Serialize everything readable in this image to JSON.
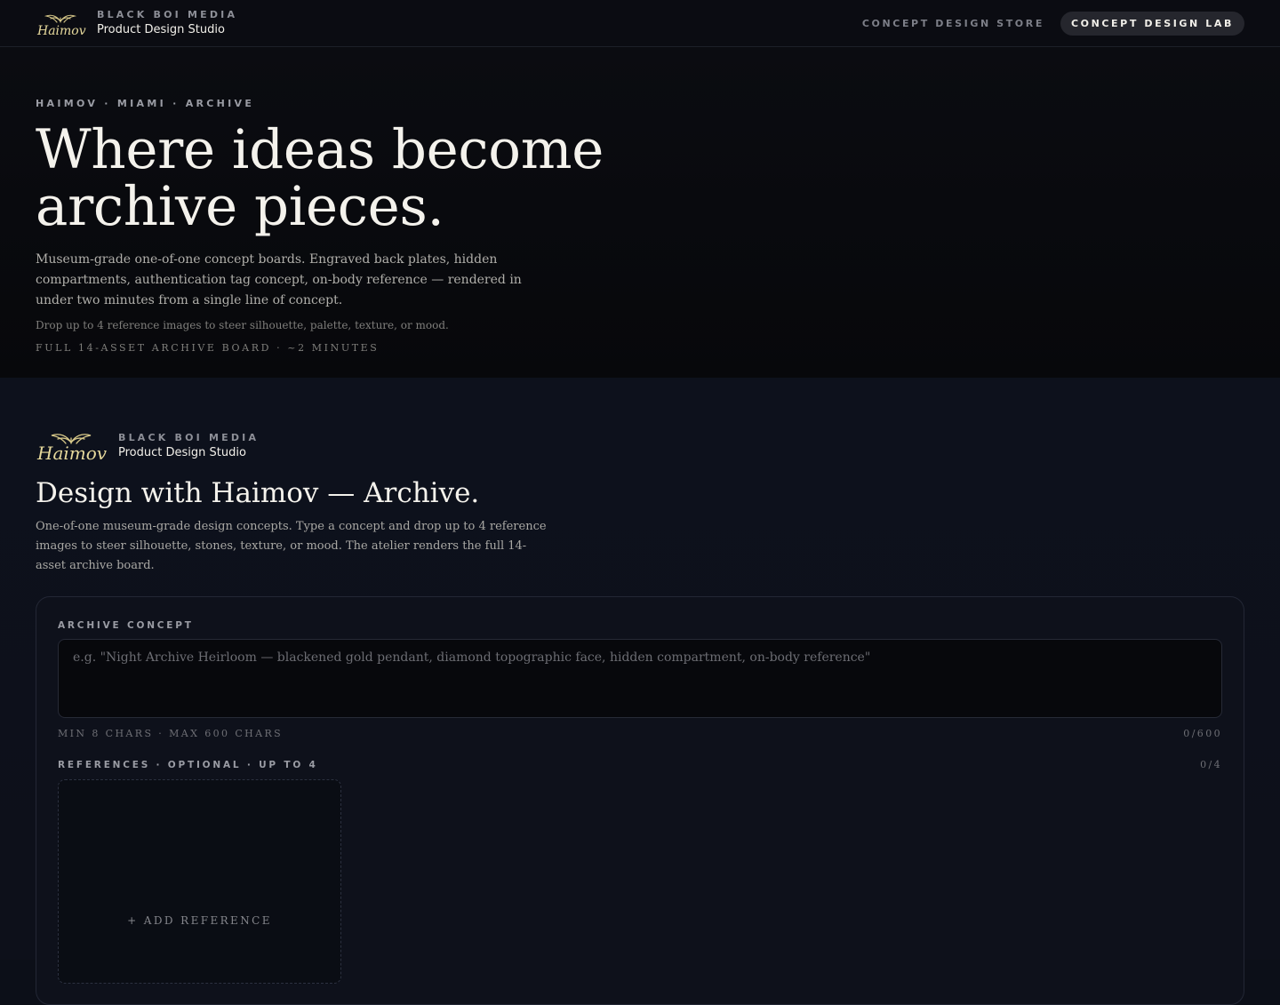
{
  "topbar": {
    "brand_kicker": "BLACK BOI MEDIA",
    "brand_name": "Product Design Studio",
    "nav": {
      "store": "CONCEPT DESIGN STORE",
      "lab": "CONCEPT DESIGN LAB"
    }
  },
  "hero": {
    "kicker": "HAIMOV · MIAMI · ARCHIVE",
    "title": "Where ideas become archive pieces.",
    "description": "Museum-grade one-of-one concept boards. Engraved back plates, hidden compartments, authentication tag concept, on-body reference — rendered in under two minutes from a single line of concept.",
    "note": "Drop up to 4 reference images to steer silhouette, palette, texture, or mood.",
    "meta": "FULL 14-ASSET ARCHIVE BOARD · ~2 MINUTES"
  },
  "section": {
    "brand_kicker": "BLACK BOI MEDIA",
    "brand_name": "Product Design Studio",
    "title": "Design with Haimov — Archive.",
    "description": "One-of-one museum-grade design concepts. Type a concept and drop up to 4 reference images to steer silhouette, stones, texture, or mood. The atelier renders the full 14-asset archive board."
  },
  "form": {
    "concept_label": "ARCHIVE CONCEPT",
    "concept_value": "",
    "concept_placeholder": "e.g. \"Night Archive Heirloom — blackened gold pendant, diamond topographic face, hidden compartment, on-body reference\"",
    "concept_hint": "MIN 8 CHARS · MAX 600 CHARS",
    "concept_count": "0/600",
    "references_label": "REFERENCES · OPTIONAL · UP TO 4",
    "references_count": "0/4",
    "add_reference": "+ ADD REFERENCE"
  },
  "colors": {
    "accent_gold": "#d8c98a",
    "background": "#0c0f18"
  },
  "icons": {
    "logo": "haimov-wings-logo"
  }
}
